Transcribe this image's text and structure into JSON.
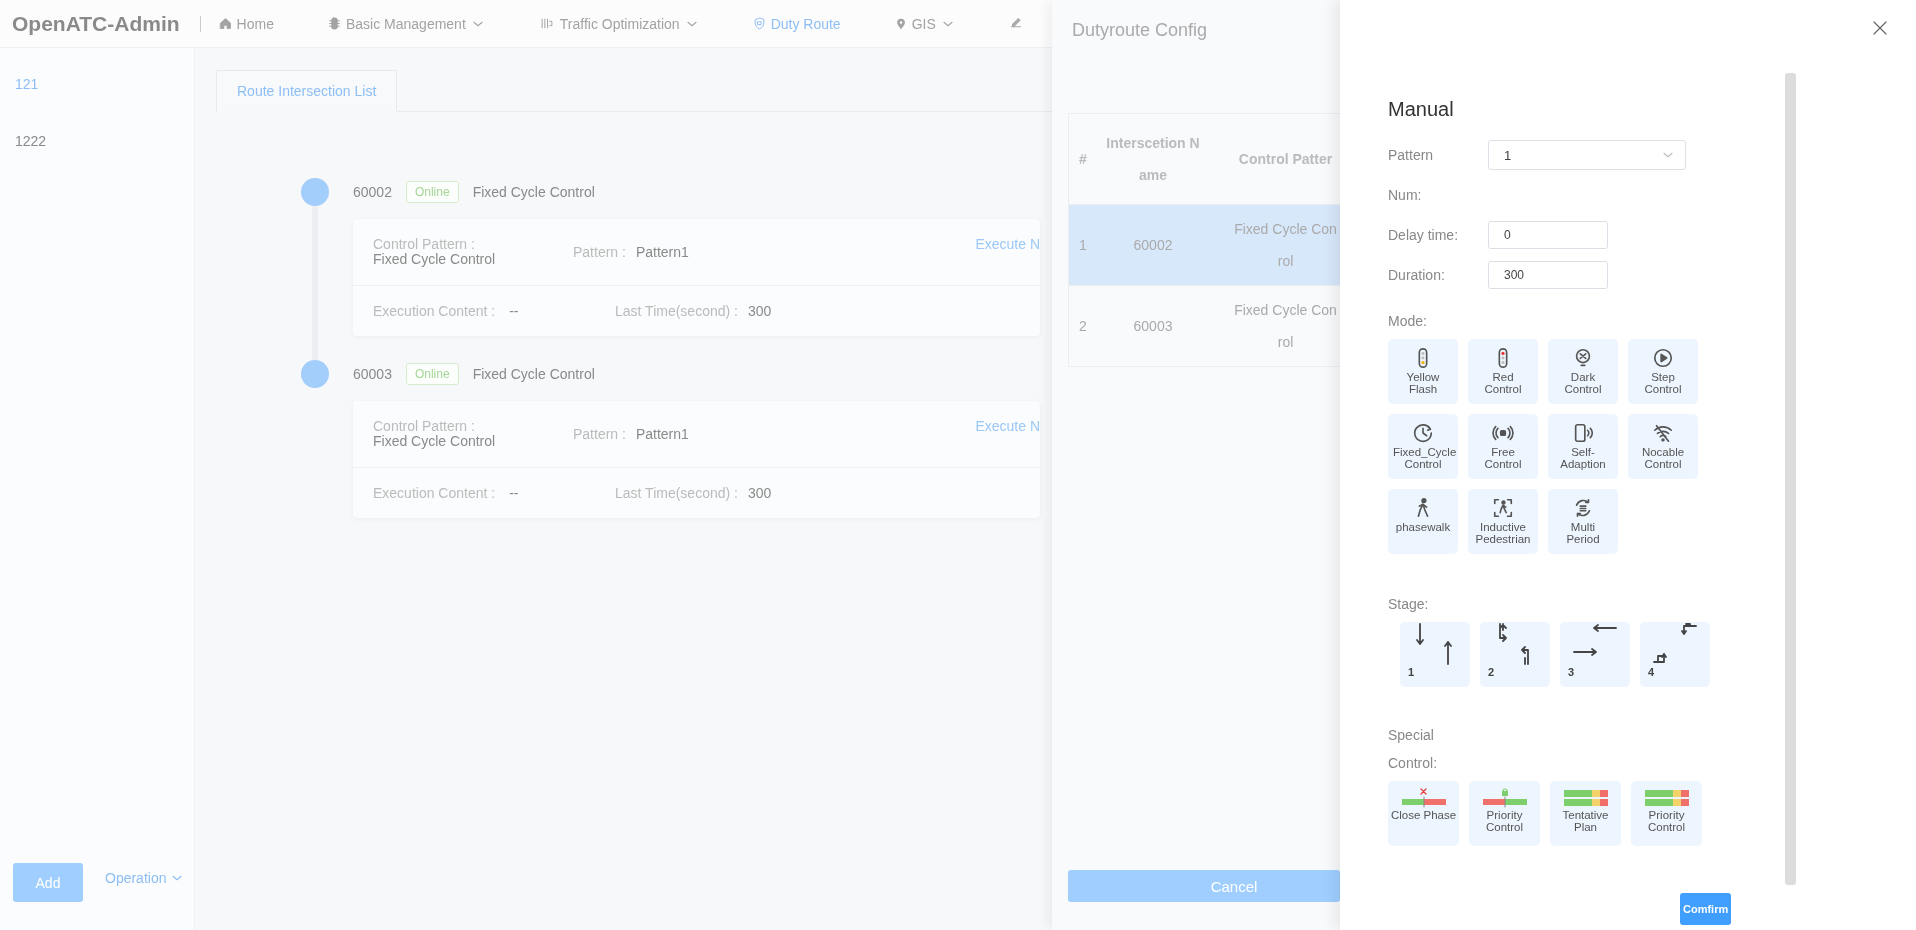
{
  "nav": {
    "logo": "OpenATC-Admin",
    "items": [
      {
        "label": "Home",
        "dropdown": false,
        "selected": false
      },
      {
        "label": "Basic Management",
        "dropdown": true,
        "selected": false
      },
      {
        "label": "Traffic Optimization",
        "dropdown": true,
        "selected": false
      },
      {
        "label": "Duty Route",
        "dropdown": false,
        "selected": true
      },
      {
        "label": "GIS",
        "dropdown": true,
        "selected": false
      }
    ]
  },
  "sidebar": {
    "items": [
      {
        "label": "121",
        "selected": true
      },
      {
        "label": "1222",
        "selected": false
      }
    ],
    "add_button": "Add",
    "operation": "Operation"
  },
  "tabs": [
    {
      "label": "Route Intersection List",
      "selected": true
    }
  ],
  "timeline": [
    {
      "id": "60002",
      "status": "Online",
      "mode": "Fixed Cycle Control",
      "control_pattern_label": "Control Pattern :",
      "control_pattern": "Fixed Cycle Control",
      "pattern_label": "Pattern :",
      "pattern": "Pattern1",
      "action": "Execute N",
      "execution_label": "Execution Content :",
      "execution": "--",
      "last_time_label": "Last Time(second) :",
      "last_time": "300"
    },
    {
      "id": "60003",
      "status": "Online",
      "mode": "Fixed Cycle Control",
      "control_pattern_label": "Control Pattern :",
      "control_pattern": "Fixed Cycle Control",
      "pattern_label": "Pattern :",
      "pattern": "Pattern1",
      "action": "Execute N",
      "execution_label": "Execution Content :",
      "execution": "--",
      "last_time_label": "Last Time(second) :",
      "last_time": "300"
    }
  ],
  "config_drawer": {
    "title": "Dutyroute Config",
    "columns": [
      "#",
      "Interscetion Name",
      "Control Patter"
    ],
    "rows": [
      {
        "index": "1",
        "name": "60002",
        "control_pattern": [
          "Fixed Cycle Con",
          "rol"
        ],
        "selected": true
      },
      {
        "index": "2",
        "name": "60003",
        "control_pattern": [
          "Fixed Cycle Con",
          "rol"
        ],
        "selected": false
      }
    ],
    "cancel_button": "Cancel"
  },
  "manual": {
    "title": "Manual",
    "pattern_label": "Pattern",
    "pattern_value": "1",
    "num_label": "Num:",
    "delay_label": "Delay time:",
    "delay_value": "0",
    "duration_label": "Duration:",
    "duration_value": "300",
    "mode_label": "Mode:",
    "modes": [
      {
        "label": "Yellow Flash"
      },
      {
        "label": "Red Control"
      },
      {
        "label": "Dark Control"
      },
      {
        "label": "Step Control"
      },
      {
        "label": "Fixed_Cycle Control"
      },
      {
        "label": "Free Control"
      },
      {
        "label": "Self-Adaption"
      },
      {
        "label": "Nocable Control"
      },
      {
        "label": "phasewalk"
      },
      {
        "label": "Inductive Pedestrian"
      },
      {
        "label": "Multi Period"
      }
    ],
    "stage_label": "Stage:",
    "stages": [
      {
        "number": "1",
        "kind": "ns"
      },
      {
        "number": "2",
        "kind": "ns-turn"
      },
      {
        "number": "3",
        "kind": "ew"
      },
      {
        "number": "4",
        "kind": "ew-turn"
      }
    ],
    "special_label": "Special Control:",
    "specials": [
      {
        "label": "Close Phase",
        "kind": "close"
      },
      {
        "label": "Priority Control",
        "kind": "lock"
      },
      {
        "label": "Tentative Plan",
        "kind": "plan"
      },
      {
        "label": "Priority Control",
        "kind": "plan"
      }
    ],
    "confirm_button": "Comfirm"
  }
}
